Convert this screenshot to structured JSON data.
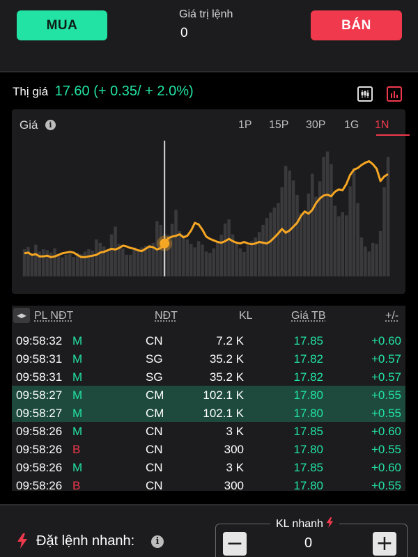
{
  "order_bar": {
    "buy_label": "MUA",
    "sell_label": "BÁN",
    "order_value_label": "Giá trị lệnh",
    "order_value": "0"
  },
  "quote": {
    "label": "Thị giá",
    "price": "17.60",
    "change": "(+ 0.35/ + 2.0%)"
  },
  "chart": {
    "title": "Giá",
    "tabs": [
      "1P",
      "15P",
      "30P",
      "1G",
      "1N"
    ],
    "active_tab": "1N"
  },
  "chart_data": {
    "type": "line",
    "description_series": "price line with volume bars",
    "price_ylim": [
      17.0,
      18.6
    ],
    "price": [
      17.12,
      17.13,
      17.1,
      17.11,
      17.08,
      17.08,
      17.09,
      17.07,
      17.08,
      17.1,
      17.12,
      17.13,
      17.14,
      17.13,
      17.1,
      17.07,
      17.07,
      17.08,
      17.09,
      17.1,
      17.13,
      17.14,
      17.16,
      17.18,
      17.17,
      17.19,
      17.22,
      17.21,
      17.19,
      17.18,
      17.16,
      17.15,
      17.18,
      17.21,
      17.2,
      17.17,
      17.19,
      17.25,
      17.32,
      17.34,
      17.35,
      17.37,
      17.33,
      17.35,
      17.42,
      17.52,
      17.5,
      17.43,
      17.34,
      17.31,
      17.29,
      17.27,
      17.26,
      17.28,
      17.31,
      17.28,
      17.26,
      17.25,
      17.27,
      17.25,
      17.24,
      17.25,
      17.27,
      17.26,
      17.25,
      17.28,
      17.33,
      17.38,
      17.44,
      17.39,
      17.42,
      17.47,
      17.52,
      17.61,
      17.67,
      17.64,
      17.69,
      17.78,
      17.84,
      17.88,
      17.89,
      17.87,
      17.93,
      17.96,
      17.95,
      18.03,
      18.15,
      18.22,
      18.24,
      18.28,
      18.31,
      18.33,
      18.29,
      18.23,
      18.07,
      18.13,
      18.16
    ],
    "volume": [
      6,
      6.5,
      5,
      7,
      5.5,
      6,
      5.8,
      5.3,
      6.2,
      4.6,
      4.2,
      4.8,
      5,
      4.3,
      5.2,
      4.9,
      5.5,
      6,
      5.7,
      8.2,
      7.4,
      6.6,
      5.6,
      9.3,
      11,
      7.2,
      6.2,
      4.8,
      4.8,
      6.4,
      5.8,
      6.4,
      6.8,
      7,
      7.4,
      12.2,
      11.4,
      9.4,
      9.2,
      11.6,
      14.7,
      10,
      9.2,
      8.2,
      7.2,
      6.4,
      7.8,
      7,
      5.5,
      5.2,
      6.2,
      7.5,
      9.2,
      11.7,
      12.6,
      9.3,
      7.2,
      6.2,
      5.4,
      6.9,
      7.8,
      8.6,
      9.8,
      11.4,
      12.9,
      14.1,
      15.2,
      16.2,
      19.7,
      24.4,
      23.4,
      21.2,
      18,
      14,
      14.4,
      18.3,
      22.7,
      17.6,
      21,
      26.4,
      27.6,
      24.8,
      15.6,
      13.3,
      14.2,
      13.5,
      19.9,
      23.9,
      16.2,
      8.6,
      6.6,
      5.5,
      7.4,
      7.2,
      10,
      19.7,
      26.4
    ],
    "volume_ylim": [
      0,
      30
    ],
    "selected_index": 37
  },
  "trades": {
    "headers": [
      "PL NĐT",
      "NĐT",
      "KL",
      "Giá TB",
      "+/-"
    ],
    "rows": [
      {
        "time": "09:58:32",
        "side": "M",
        "investor": "CN",
        "volume": "7.2 K",
        "avg_price": "17.85",
        "change": "+0.60",
        "highlight": false
      },
      {
        "time": "09:58:31",
        "side": "M",
        "investor": "SG",
        "volume": "35.2 K",
        "avg_price": "17.82",
        "change": "+0.57",
        "highlight": false
      },
      {
        "time": "09:58:31",
        "side": "M",
        "investor": "SG",
        "volume": "35.2 K",
        "avg_price": "17.82",
        "change": "+0.57",
        "highlight": false
      },
      {
        "time": "09:58:27",
        "side": "M",
        "investor": "CM",
        "volume": "102.1 K",
        "avg_price": "17.80",
        "change": "+0.55",
        "highlight": true
      },
      {
        "time": "09:58:27",
        "side": "M",
        "investor": "CM",
        "volume": "102.1 K",
        "avg_price": "17.80",
        "change": "+0.55",
        "highlight": true
      },
      {
        "time": "09:58:26",
        "side": "M",
        "investor": "CN",
        "volume": "3 K",
        "avg_price": "17.85",
        "change": "+0.60",
        "highlight": false
      },
      {
        "time": "09:58:26",
        "side": "B",
        "investor": "CN",
        "volume": "300",
        "avg_price": "17.80",
        "change": "+0.55",
        "highlight": false
      },
      {
        "time": "09:58:26",
        "side": "M",
        "investor": "CN",
        "volume": "3 K",
        "avg_price": "17.85",
        "change": "+0.60",
        "highlight": false
      },
      {
        "time": "09:58:26",
        "side": "B",
        "investor": "CN",
        "volume": "300",
        "avg_price": "17.80",
        "change": "+0.55",
        "highlight": false
      }
    ]
  },
  "quick_order": {
    "label": "Đặt lệnh nhanh:",
    "qty_label": "KL nhanh",
    "qty_value": "0",
    "minus": "−",
    "plus": "+"
  },
  "icons": {
    "info": "info-icon",
    "bolt": "lightning-bolt-icon",
    "candlestick": "candlestick-chart-icon",
    "bar": "bar-chart-icon",
    "collapse": "collapse-arrows-icon"
  },
  "colors": {
    "buy": "#22e3a4",
    "sell": "#f0394c",
    "line": "#f5a623",
    "highlight_row": "#1d4a3c"
  }
}
